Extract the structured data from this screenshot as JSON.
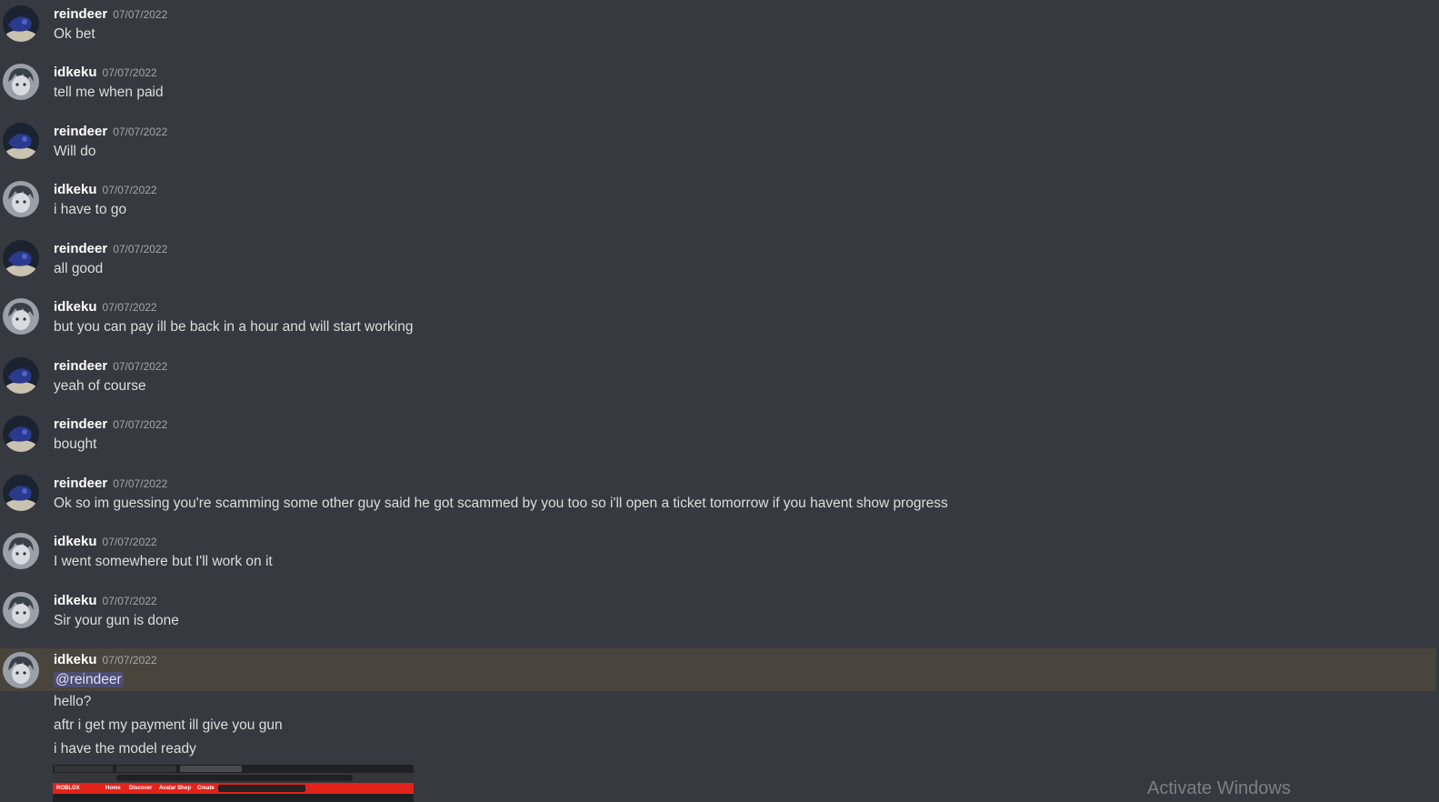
{
  "messages": [
    {
      "author": "reindeer",
      "time": "07/07/2022",
      "text": "Ok bet"
    },
    {
      "author": "idkeku",
      "time": "07/07/2022",
      "text": "tell me when paid"
    },
    {
      "author": "reindeer",
      "time": "07/07/2022",
      "text": "Will do"
    },
    {
      "author": "idkeku",
      "time": "07/07/2022",
      "text": "i have to go"
    },
    {
      "author": "reindeer",
      "time": "07/07/2022",
      "text": "all good"
    },
    {
      "author": "idkeku",
      "time": "07/07/2022",
      "text": "but you can pay ill be back in a hour and will start working"
    },
    {
      "author": "reindeer",
      "time": "07/07/2022",
      "text": "yeah of course"
    },
    {
      "author": "reindeer",
      "time": "07/07/2022",
      "text": "bought"
    },
    {
      "author": "reindeer",
      "time": "07/07/2022",
      "text": "Ok so im guessing you're scamming some other guy said he got scammed by you too so i'll open a ticket tomorrow if you havent show progress"
    },
    {
      "author": "idkeku",
      "time": "07/07/2022",
      "text": "I went somewhere but I'll work on it"
    },
    {
      "author": "idkeku",
      "time": "07/07/2022",
      "text": "Sir your gun is done"
    },
    {
      "author": "idkeku",
      "time": "07/07/2022",
      "text": "@reindeer"
    }
  ],
  "followups": [
    "hello?",
    "aftr i get my payment ill give you gun",
    "i have the model ready"
  ],
  "attachment": {
    "nav_items": [
      "ROBLOX",
      "Home",
      "Discover",
      "Avatar Shop",
      "Create"
    ]
  },
  "watermark": "Activate Windows",
  "colors": {
    "background": "#36393f",
    "highlight": "#49443c",
    "mention_bg": "#414675",
    "reindeer_avatar": "#2a3a8c",
    "idkeku_avatar": "#8a9099"
  },
  "icons": {
    "reindeer": "reindeer-avatar-icon",
    "idkeku": "idkeku-avatar-icon"
  }
}
